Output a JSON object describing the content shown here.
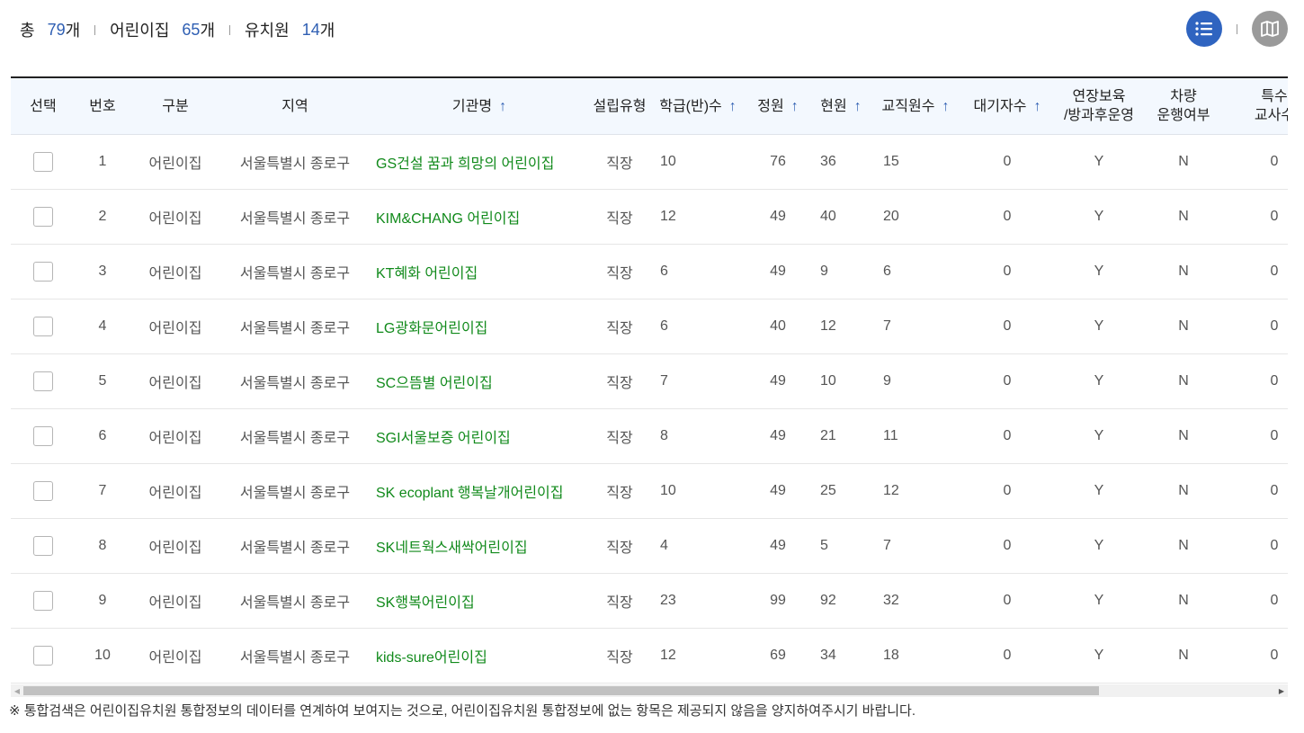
{
  "summary": {
    "total_label": "총",
    "total_count": "79",
    "total_unit": "개",
    "daycare_label": "어린이집",
    "daycare_count": "65",
    "daycare_unit": "개",
    "kinder_label": "유치원",
    "kinder_count": "14",
    "kinder_unit": "개"
  },
  "view": {
    "active": "list"
  },
  "colors": {
    "accent": "#2f64c0",
    "name_link": "#118a1b",
    "header_bg": "#f3f8fe"
  },
  "table": {
    "headers": {
      "select": "선택",
      "no": "번호",
      "type": "구분",
      "region": "지역",
      "name": "기관명",
      "found": "설립유형",
      "classes": "학급(반)수",
      "capacity": "정원",
      "current": "현원",
      "staff": "교직원수",
      "waiting": "대기자수",
      "ext_line1": "연장보육",
      "ext_line2": "/방과후운영",
      "vehicle_line1": "차량",
      "vehicle_line2": "운행여부",
      "special_line1": "특수",
      "special_line2": "교사수"
    },
    "sort_arrow": "↑",
    "rows": [
      {
        "no": "1",
        "type": "어린이집",
        "region": "서울특별시 종로구",
        "name": "GS건설 꿈과 희망의 어린이집",
        "found": "직장",
        "classes": "10",
        "capacity": "76",
        "current": "36",
        "staff": "15",
        "waiting": "0",
        "ext": "Y",
        "vehicle": "N",
        "special": "0"
      },
      {
        "no": "2",
        "type": "어린이집",
        "region": "서울특별시 종로구",
        "name": "KIM&CHANG 어린이집",
        "found": "직장",
        "classes": "12",
        "capacity": "49",
        "current": "40",
        "staff": "20",
        "waiting": "0",
        "ext": "Y",
        "vehicle": "N",
        "special": "0"
      },
      {
        "no": "3",
        "type": "어린이집",
        "region": "서울특별시 종로구",
        "name": "KT혜화 어린이집",
        "found": "직장",
        "classes": "6",
        "capacity": "49",
        "current": "9",
        "staff": "6",
        "waiting": "0",
        "ext": "Y",
        "vehicle": "N",
        "special": "0"
      },
      {
        "no": "4",
        "type": "어린이집",
        "region": "서울특별시 종로구",
        "name": "LG광화문어린이집",
        "found": "직장",
        "classes": "6",
        "capacity": "40",
        "current": "12",
        "staff": "7",
        "waiting": "0",
        "ext": "Y",
        "vehicle": "N",
        "special": "0"
      },
      {
        "no": "5",
        "type": "어린이집",
        "region": "서울특별시 종로구",
        "name": "SC으뜸별 어린이집",
        "found": "직장",
        "classes": "7",
        "capacity": "49",
        "current": "10",
        "staff": "9",
        "waiting": "0",
        "ext": "Y",
        "vehicle": "N",
        "special": "0"
      },
      {
        "no": "6",
        "type": "어린이집",
        "region": "서울특별시 종로구",
        "name": "SGI서울보증 어린이집",
        "found": "직장",
        "classes": "8",
        "capacity": "49",
        "current": "21",
        "staff": "11",
        "waiting": "0",
        "ext": "Y",
        "vehicle": "N",
        "special": "0"
      },
      {
        "no": "7",
        "type": "어린이집",
        "region": "서울특별시 종로구",
        "name": "SK ecoplant 행복날개어린이집",
        "found": "직장",
        "classes": "10",
        "capacity": "49",
        "current": "25",
        "staff": "12",
        "waiting": "0",
        "ext": "Y",
        "vehicle": "N",
        "special": "0"
      },
      {
        "no": "8",
        "type": "어린이집",
        "region": "서울특별시 종로구",
        "name": "SK네트웍스새싹어린이집",
        "found": "직장",
        "classes": "4",
        "capacity": "49",
        "current": "5",
        "staff": "7",
        "waiting": "0",
        "ext": "Y",
        "vehicle": "N",
        "special": "0"
      },
      {
        "no": "9",
        "type": "어린이집",
        "region": "서울특별시 종로구",
        "name": "SK행복어린이집",
        "found": "직장",
        "classes": "23",
        "capacity": "99",
        "current": "92",
        "staff": "32",
        "waiting": "0",
        "ext": "Y",
        "vehicle": "N",
        "special": "0"
      },
      {
        "no": "10",
        "type": "어린이집",
        "region": "서울특별시 종로구",
        "name": "kids-sure어린이집",
        "found": "직장",
        "classes": "12",
        "capacity": "69",
        "current": "34",
        "staff": "18",
        "waiting": "0",
        "ext": "Y",
        "vehicle": "N",
        "special": "0"
      }
    ]
  },
  "footer_note": "※ 통합검색은 어린이집유치원 통합정보의 데이터를 연계하여 보여지는 것으로, 어린이집유치원 통합정보에 없는 항목은 제공되지 않음을 양지하여주시기 바랍니다."
}
